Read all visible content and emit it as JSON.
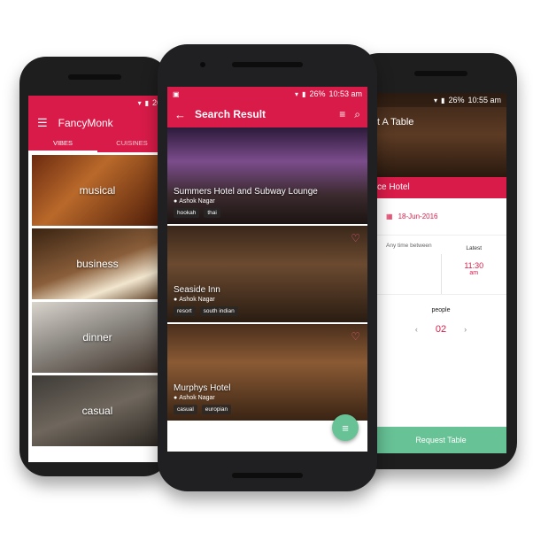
{
  "left_app": {
    "status": {
      "battery": "26"
    },
    "app_title": "FancyMonk",
    "tabs": [
      {
        "label": "VIBES"
      },
      {
        "label": "CUISINES"
      }
    ],
    "vibes": [
      {
        "label": "musical"
      },
      {
        "label": "business"
      },
      {
        "label": "dinner"
      },
      {
        "label": "casual"
      }
    ]
  },
  "center_app": {
    "status": {
      "battery": "26%",
      "time": "10:53 am"
    },
    "title": "Search Result",
    "results": [
      {
        "name": "Summers Hotel and Subway Lounge",
        "location": "Ashok Nagar",
        "tags": [
          "hookah",
          "thai"
        ]
      },
      {
        "name": "Seaside Inn",
        "location": "Ashok Nagar",
        "tags": [
          "resort",
          "south indian"
        ]
      },
      {
        "name": "Murphys Hotel",
        "location": "Ashok Nagar",
        "tags": [
          "casual",
          "europian"
        ]
      }
    ]
  },
  "right_app": {
    "status": {
      "battery": "26%",
      "time": "10:55 am"
    },
    "title_partial": "t A Table",
    "banner_partial": "ce Hotel",
    "date": "18-Jun-2016",
    "any_time_label": "Any time between",
    "latest_label": "Latest",
    "latest_time": "11:30",
    "latest_ampm": "am",
    "people_label": "people",
    "people_count": "02",
    "request_label": "Request Table"
  },
  "colors": {
    "brand": "#d81b48",
    "accent": "#67c296",
    "phone": "#1e1e1f"
  }
}
